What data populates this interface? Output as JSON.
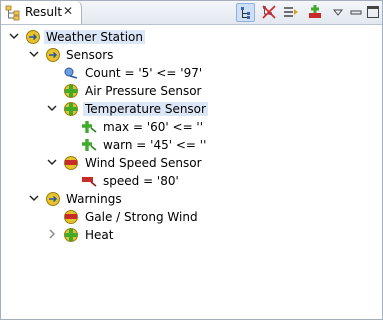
{
  "tab": {
    "label": "Result",
    "close": "✕",
    "icon": "result-view-icon"
  },
  "toolbar": {
    "buttons": [
      {
        "name": "hierarchy-icon",
        "active": true
      },
      {
        "name": "remove-icon",
        "active": false
      },
      {
        "name": "expand-all-icon",
        "active": false
      },
      {
        "name": "add-icon",
        "active": false
      },
      {
        "name": "view-menu-icon",
        "active": false
      },
      {
        "name": "minimize-icon",
        "active": false
      },
      {
        "name": "maximize-icon",
        "active": false
      }
    ]
  },
  "tree": {
    "root": {
      "label": "Weather Station",
      "icon": "info-node-icon",
      "expanded": true
    },
    "sensors": {
      "label": "Sensors",
      "icon": "info-node-icon",
      "expanded": true
    },
    "count": {
      "label": "Count = '5' <= '97'",
      "icon": "blue-arrow-icon"
    },
    "air": {
      "label": "Air Pressure Sensor",
      "icon": "green-ok-icon"
    },
    "temp": {
      "label": "Temperature Sensor",
      "icon": "green-ok-icon",
      "expanded": true
    },
    "max": {
      "label": "max = '60' <= ''",
      "icon": "green-arrow-icon"
    },
    "warn": {
      "label": "warn = '45' <= ''",
      "icon": "green-arrow-icon"
    },
    "wind": {
      "label": "Wind Speed Sensor",
      "icon": "red-error-icon",
      "expanded": true
    },
    "speed": {
      "label": "speed = '80'",
      "icon": "red-arrow-icon"
    },
    "warnings": {
      "label": "Warnings",
      "icon": "info-node-icon",
      "expanded": true
    },
    "gale": {
      "label": "Gale / Strong Wind",
      "icon": "red-error-icon"
    },
    "heat": {
      "label": "Heat",
      "icon": "green-ok-icon",
      "expanded": false
    }
  },
  "colors": {
    "selection": "#dbe6f6",
    "ok": "#3faa2c",
    "error": "#c92b2b",
    "info": "#e6c22b"
  }
}
